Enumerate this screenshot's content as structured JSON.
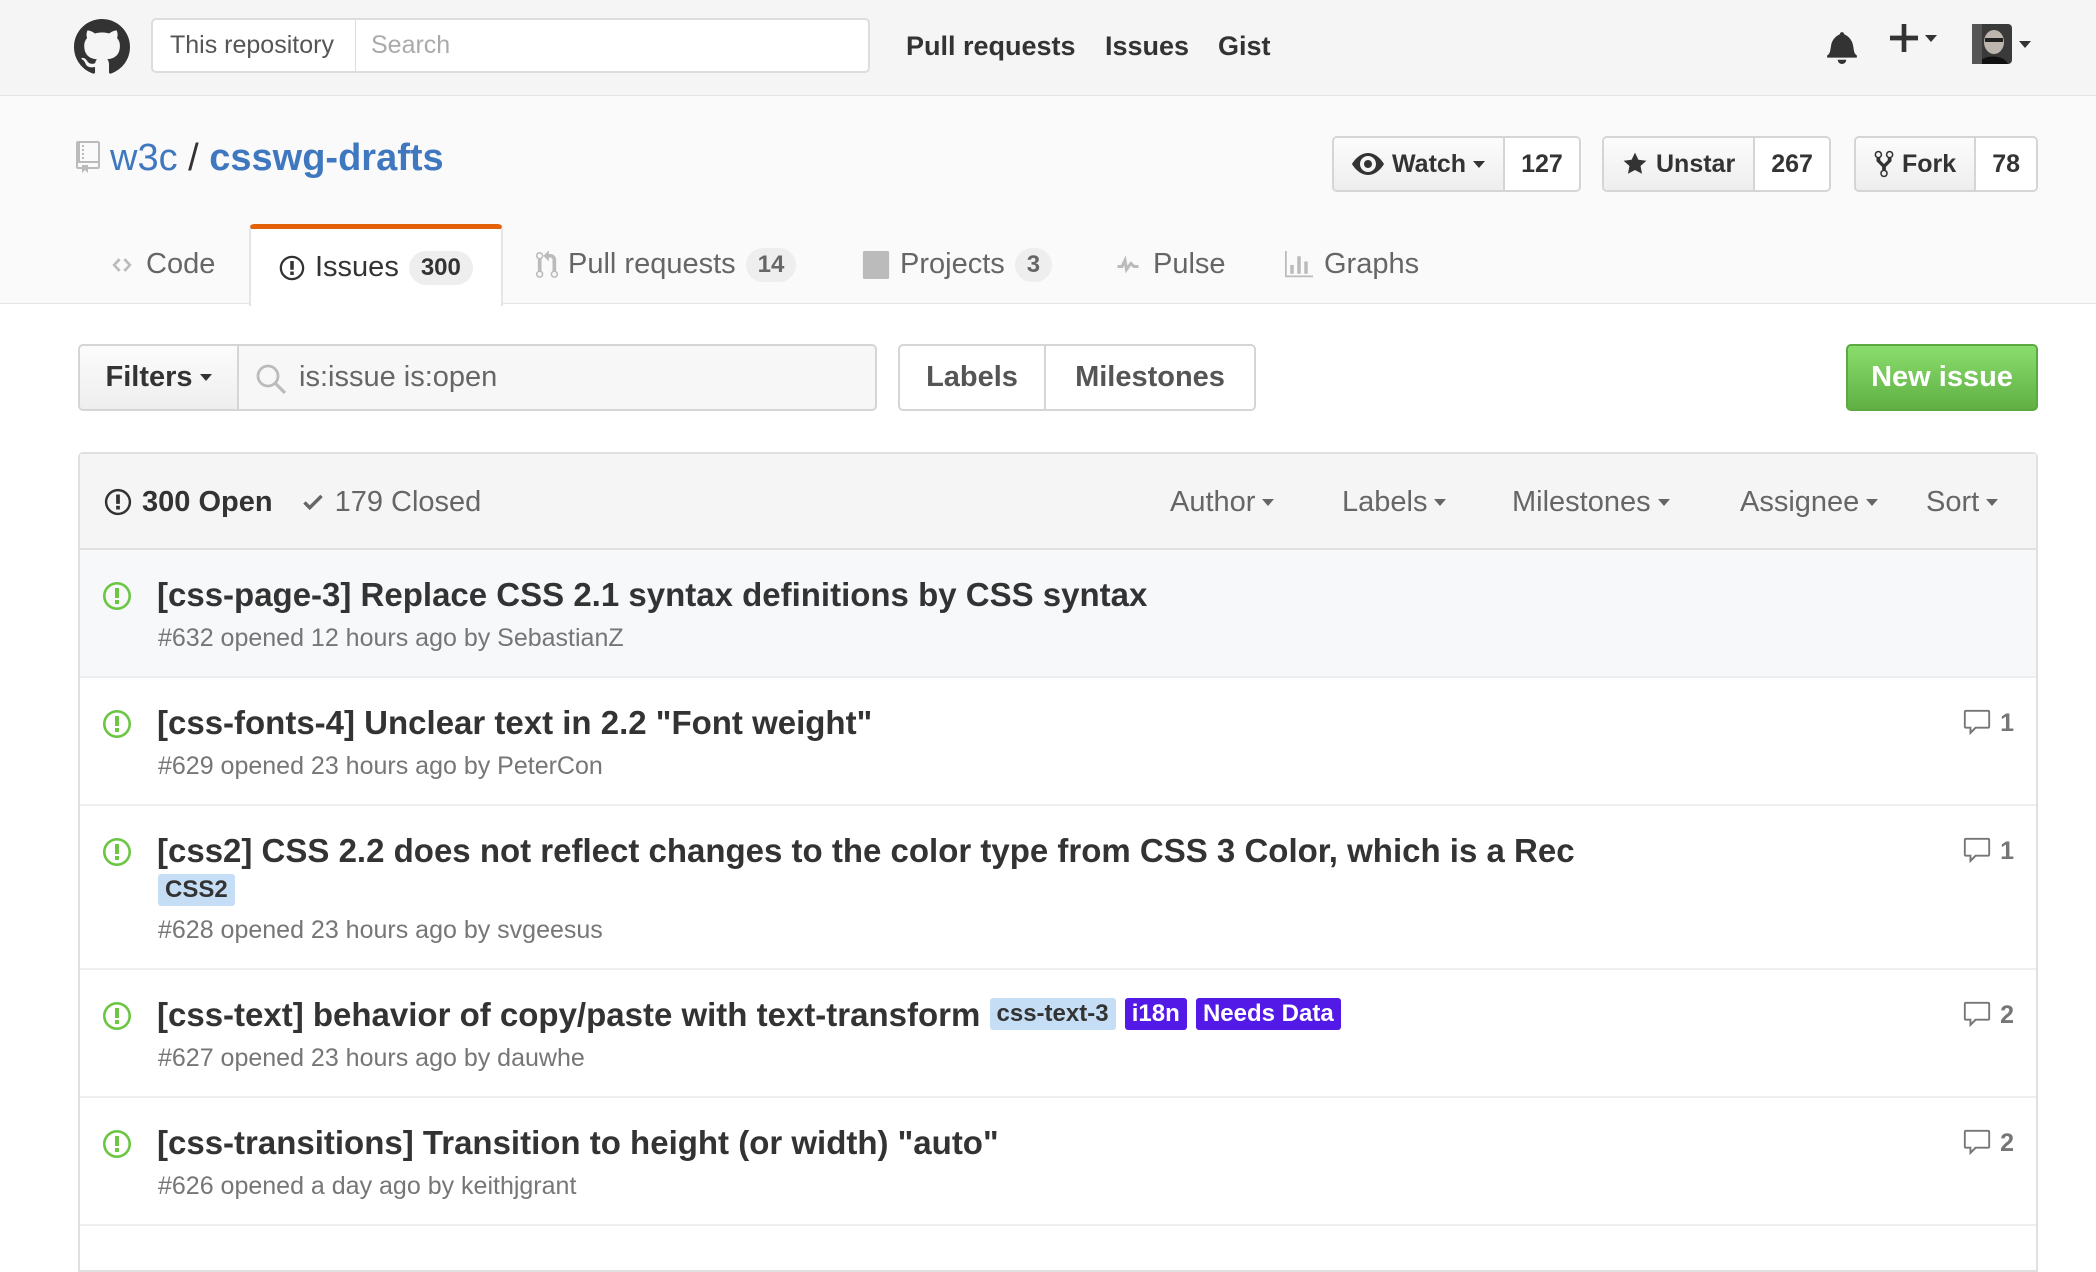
{
  "header": {
    "search_scope": "This repository",
    "search_placeholder": "Search",
    "nav": [
      "Pull requests",
      "Issues",
      "Gist"
    ],
    "icons": [
      "github-logo-icon",
      "bell-icon",
      "plus-icon",
      "avatar"
    ]
  },
  "repo": {
    "owner": "w3c",
    "separator": "/",
    "name": "csswg-drafts",
    "watch_label": "Watch",
    "watch_count": "127",
    "star_label": "Unstar",
    "star_count": "267",
    "fork_label": "Fork",
    "fork_count": "78"
  },
  "tabs": [
    {
      "label": "Code",
      "counter": ""
    },
    {
      "label": "Issues",
      "counter": "300"
    },
    {
      "label": "Pull requests",
      "counter": "14"
    },
    {
      "label": "Projects",
      "counter": "3"
    },
    {
      "label": "Pulse",
      "counter": ""
    },
    {
      "label": "Graphs",
      "counter": ""
    }
  ],
  "filterbar": {
    "filters_label": "Filters",
    "query": "is:issue is:open",
    "labels_label": "Labels",
    "milestones_label": "Milestones",
    "new_issue_label": "New issue"
  },
  "issues_header": {
    "open_label": "300 Open",
    "closed_label": "179 Closed",
    "filters": [
      "Author",
      "Labels",
      "Milestones",
      "Assignee",
      "Sort"
    ]
  },
  "issues": [
    {
      "title": "[css-page-3] Replace CSS 2.1 syntax definitions by CSS syntax",
      "meta": "#632 opened 12 hours ago by SebastianZ",
      "comments": ""
    },
    {
      "title": "[css-fonts-4] Unclear text in 2.2 \"Font weight\"",
      "meta": "#629 opened 23 hours ago by PeterCon",
      "comments": "1"
    },
    {
      "title": "[css2] CSS 2.2 does not reflect changes to the color type from CSS 3 Color, which is a Rec",
      "meta": "#628 opened 23 hours ago by svgeesus",
      "comments": "1",
      "labels": [
        {
          "name": "CSS2",
          "color": "#c5def5",
          "text_color": "#333333"
        }
      ]
    },
    {
      "title": "[css-text] behavior of copy/paste with text-transform",
      "meta": "#627 opened 23 hours ago by dauwhe",
      "comments": "2",
      "labels": [
        {
          "name": "css-text-3",
          "color": "#c5def5",
          "text_color": "#333333"
        },
        {
          "name": "i18n",
          "color": "#5319e7",
          "text_color": "#ffffff"
        },
        {
          "name": "Needs Data",
          "color": "#5319e7",
          "text_color": "#ffffff"
        }
      ]
    },
    {
      "title": "[css-transitions] Transition to height (or width) \"auto\"",
      "meta": "#626 opened a day ago by keithjgrant",
      "comments": "2"
    }
  ],
  "colors": {
    "link": "#4078c0",
    "open_green": "#6cc644",
    "new_issue_green": "#60b044",
    "tab_accent": "#e36209"
  }
}
